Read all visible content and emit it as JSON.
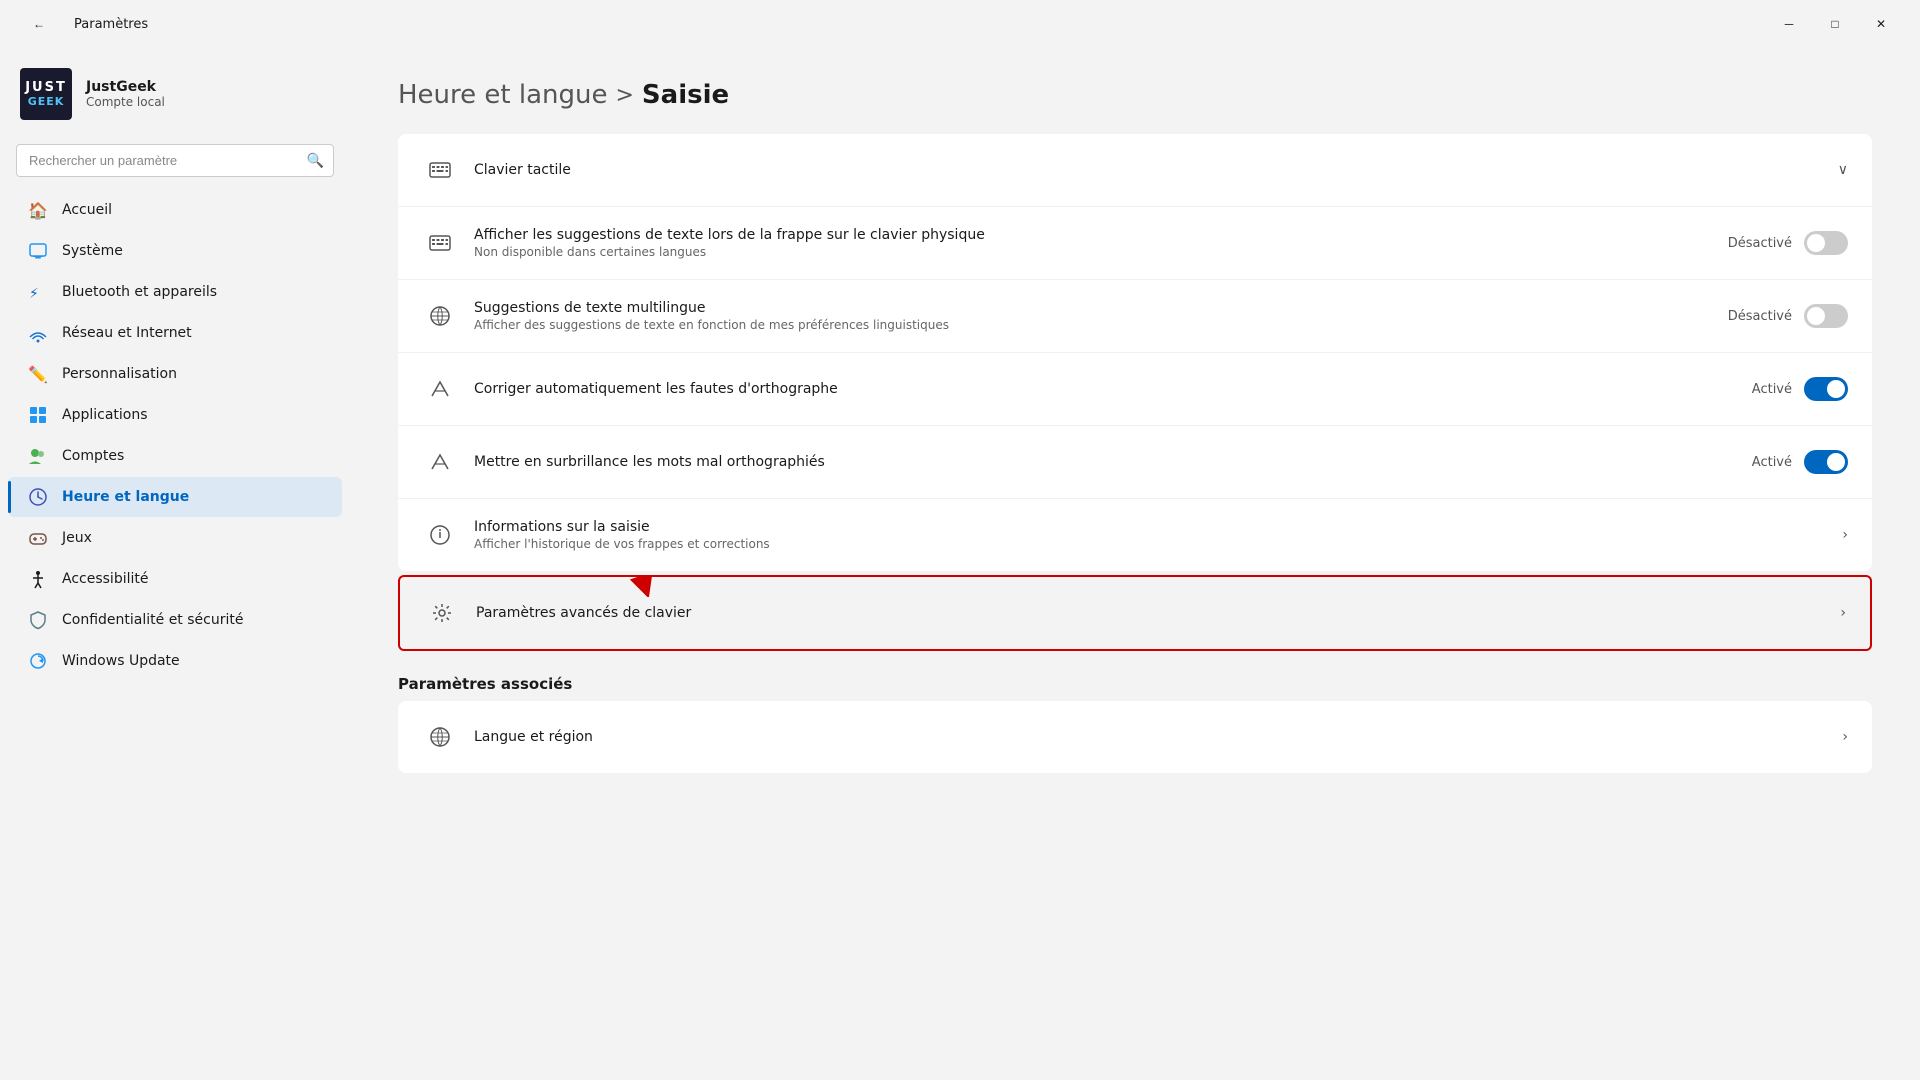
{
  "titlebar": {
    "title": "Paramètres",
    "back_label": "←",
    "minimize_label": "─",
    "maximize_label": "□",
    "close_label": "✕"
  },
  "sidebar": {
    "logo_just": "JUST",
    "logo_geek": "GEEK",
    "username": "JustGeek",
    "account": "Compte local",
    "search_placeholder": "Rechercher un paramètre",
    "nav_items": [
      {
        "id": "accueil",
        "label": "Accueil",
        "icon": "🏠"
      },
      {
        "id": "systeme",
        "label": "Système",
        "icon": "💻"
      },
      {
        "id": "bluetooth",
        "label": "Bluetooth et appareils",
        "icon": "🔵"
      },
      {
        "id": "reseau",
        "label": "Réseau et Internet",
        "icon": "📶"
      },
      {
        "id": "personnalisation",
        "label": "Personnalisation",
        "icon": "✏️"
      },
      {
        "id": "applications",
        "label": "Applications",
        "icon": "🔲"
      },
      {
        "id": "comptes",
        "label": "Comptes",
        "icon": "👥"
      },
      {
        "id": "heure",
        "label": "Heure et langue",
        "icon": "🌐",
        "active": true
      },
      {
        "id": "jeux",
        "label": "Jeux",
        "icon": "🎮"
      },
      {
        "id": "accessibilite",
        "label": "Accessibilité",
        "icon": "♿"
      },
      {
        "id": "confidentialite",
        "label": "Confidentialité et sécurité",
        "icon": "🛡️"
      },
      {
        "id": "update",
        "label": "Windows Update",
        "icon": "🔄"
      }
    ]
  },
  "breadcrumb": {
    "parent": "Heure et langue",
    "separator": ">",
    "current": "Saisie"
  },
  "settings": {
    "items": [
      {
        "id": "clavier-tactile",
        "icon": "⌨️",
        "title": "Clavier tactile",
        "subtitle": "",
        "type": "collapsible",
        "right": "chevron-down"
      },
      {
        "id": "suggestions-texte",
        "icon": "⌨️",
        "title": "Afficher les suggestions de texte lors de la frappe sur le clavier physique",
        "subtitle": "Non disponible dans certaines langues",
        "type": "toggle",
        "toggle_label": "Désactivé",
        "toggle_state": "off"
      },
      {
        "id": "suggestions-multilingue",
        "icon": "🌐",
        "title": "Suggestions de texte multilingue",
        "subtitle": "Afficher des suggestions de texte en fonction de mes préférences linguistiques",
        "type": "toggle",
        "toggle_label": "Désactivé",
        "toggle_state": "off"
      },
      {
        "id": "correction-orthographe",
        "icon": "✏️",
        "title": "Corriger automatiquement les fautes d'orthographe",
        "subtitle": "",
        "type": "toggle",
        "toggle_label": "Activé",
        "toggle_state": "on"
      },
      {
        "id": "surbrillance-mots",
        "icon": "✏️",
        "title": "Mettre en surbrillance les mots mal orthographiés",
        "subtitle": "",
        "type": "toggle",
        "toggle_label": "Activé",
        "toggle_state": "on"
      },
      {
        "id": "informations-saisie",
        "icon": "🔄",
        "title": "Informations sur la saisie",
        "subtitle": "Afficher l'historique de vos frappes et corrections",
        "type": "link",
        "right": "chevron-right"
      }
    ],
    "highlighted_item": {
      "id": "parametres-avances",
      "icon": "⚙️",
      "title": "Paramètres avancés de clavier",
      "subtitle": "",
      "type": "link",
      "right": "chevron-right"
    },
    "related_title": "Paramètres associés",
    "related_items": [
      {
        "id": "langue-region",
        "icon": "🌐",
        "title": "Langue et région",
        "subtitle": "",
        "type": "link",
        "right": "chevron-right"
      }
    ]
  }
}
